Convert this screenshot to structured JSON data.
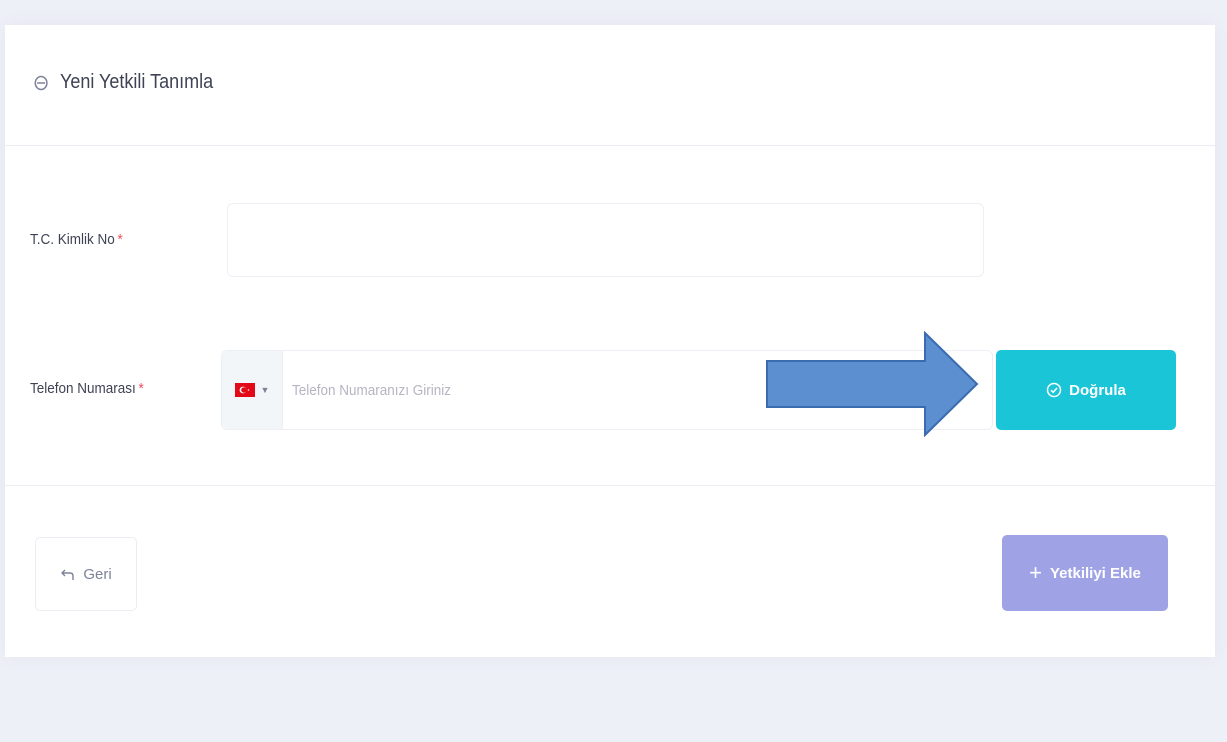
{
  "header": {
    "title": "Yeni Yetkili Tanımla",
    "icon": "user-lock-icon"
  },
  "form": {
    "tc_label": "T.C. Kimlik No",
    "tc_value": "",
    "phone_label": "Telefon Numarası",
    "phone_placeholder": "Telefon Numaranızı Giriniz",
    "country_flag": "turkey-flag-icon",
    "required_mark": "*"
  },
  "actions": {
    "verify_label": "Doğrula",
    "back_label": "Geri",
    "add_label": "Yetkiliyi Ekle"
  },
  "colors": {
    "accent_cyan": "#1bc5d8",
    "accent_purple": "#9fa3e6",
    "required_red": "#f64e60",
    "arrow_blue": "#5b8fd0"
  }
}
